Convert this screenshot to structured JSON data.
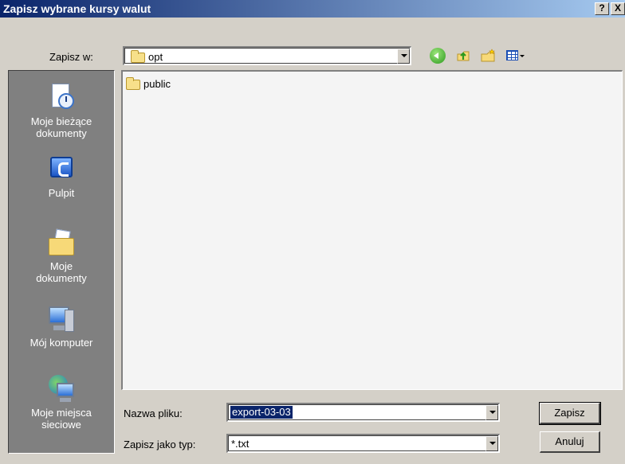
{
  "window": {
    "title": "Zapisz wybrane kursy walut",
    "help_label": "?",
    "close_label": "X"
  },
  "save_in": {
    "label": "Zapisz w:",
    "value": "opt"
  },
  "toolbar": {
    "icons": [
      "back-icon",
      "up-folder-icon",
      "new-folder-icon",
      "views-menu-icon"
    ]
  },
  "places": [
    {
      "label": "Moje bieżące dokumenty",
      "icon": "recent-documents-icon"
    },
    {
      "label": "Pulpit",
      "icon": "desktop-icon"
    },
    {
      "label": "Moje dokumenty",
      "icon": "my-documents-icon"
    },
    {
      "label": "Mój komputer",
      "icon": "my-computer-icon"
    },
    {
      "label": "Moje miejsca sieciowe",
      "icon": "network-places-icon"
    }
  ],
  "files": [
    {
      "name": "public",
      "icon": "folder-icon"
    }
  ],
  "filename": {
    "label": "Nazwa pliku:",
    "value": "export-03-03"
  },
  "filetype": {
    "label": "Zapisz jako typ:",
    "value": "*.txt"
  },
  "buttons": {
    "save": "Zapisz",
    "cancel": "Anuluj"
  },
  "colors": {
    "title_bar_start": "#0a246a",
    "title_bar_end": "#a6caf0",
    "dialog_bg": "#d4d0c8",
    "places_bg": "#808080",
    "selection": "#0a246a"
  }
}
